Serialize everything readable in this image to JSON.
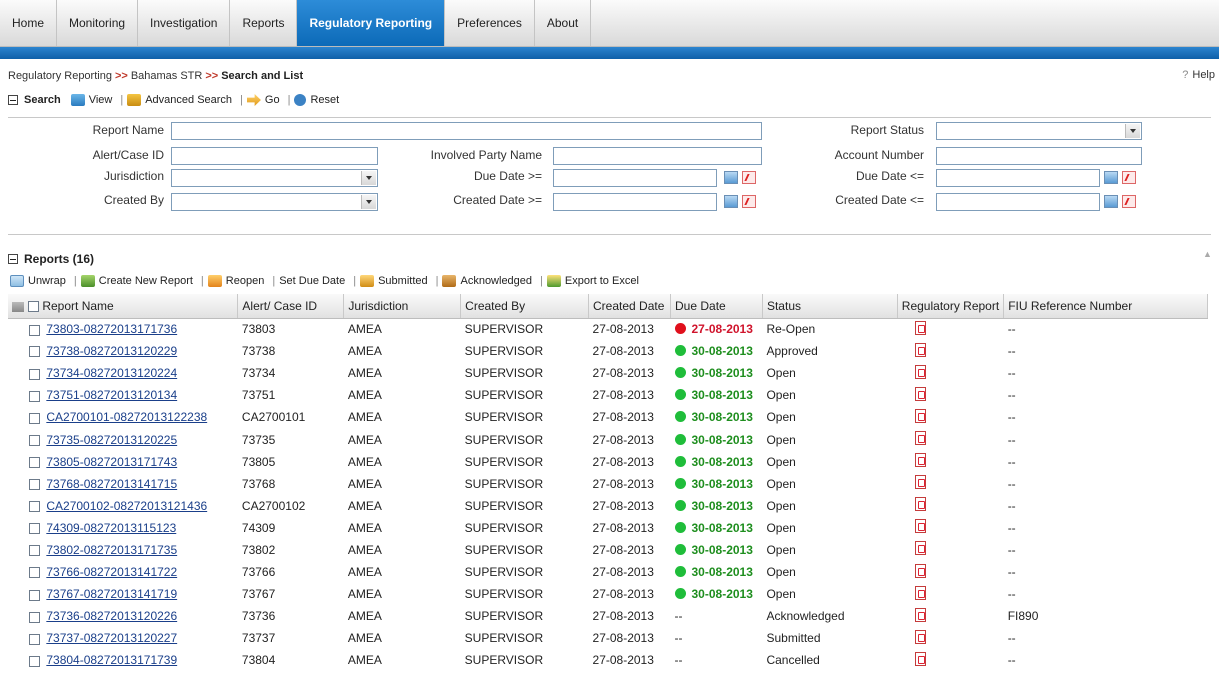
{
  "nav": {
    "tabs": [
      "Home",
      "Monitoring",
      "Investigation",
      "Reports",
      "Regulatory Reporting",
      "Preferences",
      "About"
    ],
    "active_index": 4
  },
  "breadcrumb": {
    "part1": "Regulatory Reporting",
    "sep": ">>",
    "part2": "Bahamas STR",
    "part3": "Search and List"
  },
  "help_label": "Help",
  "search": {
    "title": "Search",
    "view": "View",
    "advanced": "Advanced Search",
    "go": "Go",
    "reset": "Reset",
    "fields": {
      "report_name": "Report Name",
      "report_status": "Report Status",
      "alert_case_id": "Alert/Case ID",
      "involved_party": "Involved Party Name",
      "account_number": "Account Number",
      "jurisdiction": "Jurisdiction",
      "due_from": "Due Date >=",
      "due_to": "Due Date <=",
      "created_by": "Created By",
      "created_from": "Created Date >=",
      "created_to": "Created Date <="
    }
  },
  "reports": {
    "title": "Reports (16)",
    "toolbar": {
      "unwrap": "Unwrap",
      "create": "Create New Report",
      "reopen": "Reopen",
      "set_due": "Set Due Date",
      "submitted": "Submitted",
      "acknowledged": "Acknowledged",
      "export": "Export to Excel"
    },
    "columns": [
      "Report Name",
      "Alert/ Case ID",
      "Jurisdiction",
      "Created By",
      "Created Date",
      "Due Date",
      "Status",
      "Regulatory Report",
      "FIU Reference Number"
    ],
    "colors": {
      "red": "#e0101c",
      "green": "#1fbd3a"
    },
    "rows": [
      {
        "name": "73803-08272013171736",
        "id": "73803",
        "jur": "AMEA",
        "by": "SUPERVISOR",
        "created": "27-08-2013",
        "due": "27-08-2013",
        "dot": "red",
        "status": "Re-Open",
        "fiu": "--"
      },
      {
        "name": "73738-08272013120229",
        "id": "73738",
        "jur": "AMEA",
        "by": "SUPERVISOR",
        "created": "27-08-2013",
        "due": "30-08-2013",
        "dot": "green",
        "status": "Approved",
        "fiu": "--"
      },
      {
        "name": "73734-08272013120224",
        "id": "73734",
        "jur": "AMEA",
        "by": "SUPERVISOR",
        "created": "27-08-2013",
        "due": "30-08-2013",
        "dot": "green",
        "status": "Open",
        "fiu": "--"
      },
      {
        "name": "73751-08272013120134",
        "id": "73751",
        "jur": "AMEA",
        "by": "SUPERVISOR",
        "created": "27-08-2013",
        "due": "30-08-2013",
        "dot": "green",
        "status": "Open",
        "fiu": "--"
      },
      {
        "name": "CA2700101-08272013122238",
        "id": "CA2700101",
        "jur": "AMEA",
        "by": "SUPERVISOR",
        "created": "27-08-2013",
        "due": "30-08-2013",
        "dot": "green",
        "status": "Open",
        "fiu": "--"
      },
      {
        "name": "73735-08272013120225",
        "id": "73735",
        "jur": "AMEA",
        "by": "SUPERVISOR",
        "created": "27-08-2013",
        "due": "30-08-2013",
        "dot": "green",
        "status": "Open",
        "fiu": "--"
      },
      {
        "name": "73805-08272013171743",
        "id": "73805",
        "jur": "AMEA",
        "by": "SUPERVISOR",
        "created": "27-08-2013",
        "due": "30-08-2013",
        "dot": "green",
        "status": "Open",
        "fiu": "--"
      },
      {
        "name": "73768-08272013141715",
        "id": "73768",
        "jur": "AMEA",
        "by": "SUPERVISOR",
        "created": "27-08-2013",
        "due": "30-08-2013",
        "dot": "green",
        "status": "Open",
        "fiu": "--"
      },
      {
        "name": "CA2700102-08272013121436",
        "id": "CA2700102",
        "jur": "AMEA",
        "by": "SUPERVISOR",
        "created": "27-08-2013",
        "due": "30-08-2013",
        "dot": "green",
        "status": "Open",
        "fiu": "--"
      },
      {
        "name": "74309-08272013115123",
        "id": "74309",
        "jur": "AMEA",
        "by": "SUPERVISOR",
        "created": "27-08-2013",
        "due": "30-08-2013",
        "dot": "green",
        "status": "Open",
        "fiu": "--"
      },
      {
        "name": "73802-08272013171735",
        "id": "73802",
        "jur": "AMEA",
        "by": "SUPERVISOR",
        "created": "27-08-2013",
        "due": "30-08-2013",
        "dot": "green",
        "status": "Open",
        "fiu": "--"
      },
      {
        "name": "73766-08272013141722",
        "id": "73766",
        "jur": "AMEA",
        "by": "SUPERVISOR",
        "created": "27-08-2013",
        "due": "30-08-2013",
        "dot": "green",
        "status": "Open",
        "fiu": "--"
      },
      {
        "name": "73767-08272013141719",
        "id": "73767",
        "jur": "AMEA",
        "by": "SUPERVISOR",
        "created": "27-08-2013",
        "due": "30-08-2013",
        "dot": "green",
        "status": "Open",
        "fiu": "--"
      },
      {
        "name": "73736-08272013120226",
        "id": "73736",
        "jur": "AMEA",
        "by": "SUPERVISOR",
        "created": "27-08-2013",
        "due": "--",
        "dot": "",
        "status": "Acknowledged",
        "fiu": "FI890"
      },
      {
        "name": "73737-08272013120227",
        "id": "73737",
        "jur": "AMEA",
        "by": "SUPERVISOR",
        "created": "27-08-2013",
        "due": "--",
        "dot": "",
        "status": "Submitted",
        "fiu": "--"
      },
      {
        "name": "73804-08272013171739",
        "id": "73804",
        "jur": "AMEA",
        "by": "SUPERVISOR",
        "created": "27-08-2013",
        "due": "--",
        "dot": "",
        "status": "Cancelled",
        "fiu": "--"
      }
    ]
  }
}
